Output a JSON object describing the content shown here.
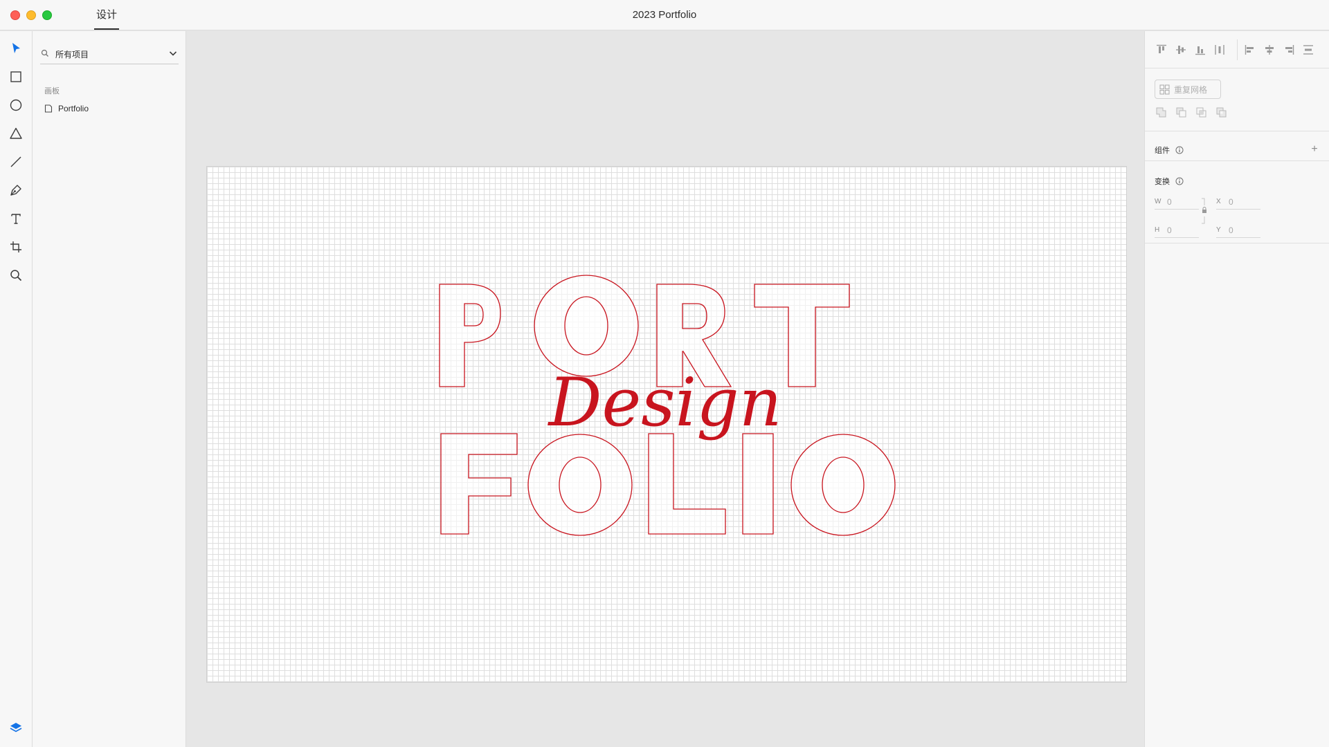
{
  "window": {
    "title": "2023 Portfolio",
    "mode_tab": "设计"
  },
  "toolbar": {
    "tools": [
      "select-tool",
      "rectangle-tool",
      "ellipse-tool",
      "polygon-tool",
      "line-tool",
      "pen-tool",
      "text-tool",
      "artboard-tool",
      "zoom-tool"
    ],
    "bottom": "layers-icon"
  },
  "layers": {
    "search": {
      "value": "所有项目"
    },
    "section_label": "画板",
    "items": [
      {
        "label": "Portfolio",
        "icon": "artboard-icon"
      }
    ]
  },
  "canvas": {
    "artwork": {
      "outline_line1": "PORT",
      "outline_line2": "FOLIO",
      "script_text": "Design",
      "color": "#c8141e"
    }
  },
  "properties": {
    "repeat_grid_label": "重复网格",
    "components_label": "组件",
    "transform_label": "变换",
    "fields": {
      "w": {
        "label": "W",
        "value": "0"
      },
      "h": {
        "label": "H",
        "value": "0"
      },
      "x": {
        "label": "X",
        "value": "0"
      },
      "y": {
        "label": "Y",
        "value": "0"
      }
    },
    "add_symbol": "+"
  }
}
